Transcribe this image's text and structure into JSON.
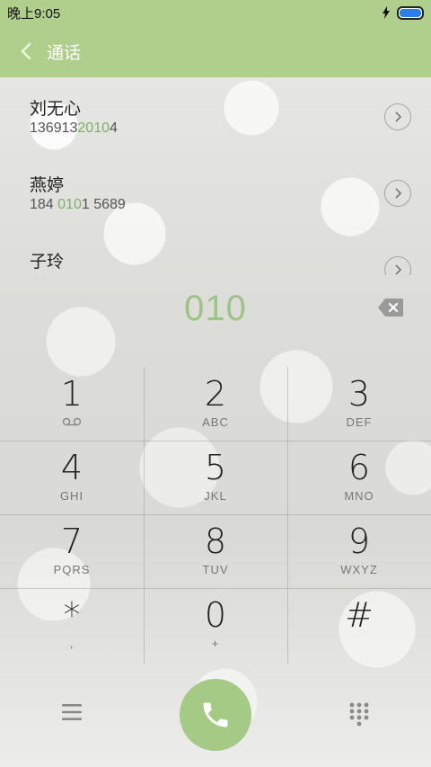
{
  "status_bar": {
    "time": "晚上9:05"
  },
  "app_bar": {
    "title": "通话"
  },
  "contacts": [
    {
      "name": "刘无心",
      "number_pre": "136913",
      "number_match": "2010",
      "number_post": "4"
    },
    {
      "name": "燕婷",
      "number_pre": "184 ",
      "number_match": "010",
      "number_post": "1 5689"
    },
    {
      "name": "子玲",
      "number_pre": "",
      "number_match": "",
      "number_post": ""
    }
  ],
  "dialer": {
    "entered_number": "010"
  },
  "keypad": [
    {
      "digit": "1",
      "letters": ""
    },
    {
      "digit": "2",
      "letters": "ABC"
    },
    {
      "digit": "3",
      "letters": "DEF"
    },
    {
      "digit": "4",
      "letters": "GHI"
    },
    {
      "digit": "5",
      "letters": "JKL"
    },
    {
      "digit": "6",
      "letters": "MNO"
    },
    {
      "digit": "7",
      "letters": "PQRS"
    },
    {
      "digit": "8",
      "letters": "TUV"
    },
    {
      "digit": "9",
      "letters": "WXYZ"
    },
    {
      "digit": "*",
      "letters": ","
    },
    {
      "digit": "0",
      "letters": "+"
    },
    {
      "digit": "#",
      "letters": ""
    }
  ],
  "colors": {
    "accent": "#b1cf8c",
    "highlight": "#7fb069",
    "call_button": "#a4ca86"
  }
}
